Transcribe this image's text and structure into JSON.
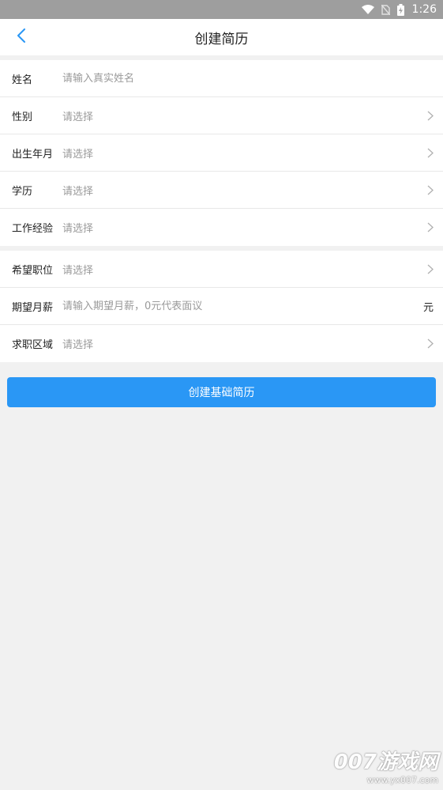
{
  "status_bar": {
    "time": "1:26",
    "icons": [
      "wifi-icon",
      "no-sim-icon",
      "battery-charging-icon"
    ]
  },
  "nav": {
    "back_icon": "chevron-left-icon",
    "title": "创建简历"
  },
  "group1": {
    "rows": [
      {
        "label": "姓名",
        "placeholder": "请输入真实姓名",
        "type": "input"
      },
      {
        "label": "性别",
        "placeholder": "请选择",
        "type": "select"
      },
      {
        "label": "出生年月",
        "placeholder": "请选择",
        "type": "select"
      },
      {
        "label": "学历",
        "placeholder": "请选择",
        "type": "select"
      },
      {
        "label": "工作经验",
        "placeholder": "请选择",
        "type": "select"
      }
    ]
  },
  "group2": {
    "rows": [
      {
        "label": "希望职位",
        "placeholder": "请选择",
        "type": "select"
      },
      {
        "label": "期望月薪",
        "placeholder": "请输入期望月薪，0元代表面议",
        "type": "input",
        "unit": "元"
      },
      {
        "label": "求职区域",
        "placeholder": "请选择",
        "type": "select"
      }
    ]
  },
  "submit": {
    "label": "创建基础简历"
  },
  "watermark": {
    "main": "007游戏网",
    "sub": "www.yx007.com"
  },
  "colors": {
    "accent": "#2a97f5",
    "back_icon": "#2a97f5",
    "background": "#f1f1f1"
  }
}
